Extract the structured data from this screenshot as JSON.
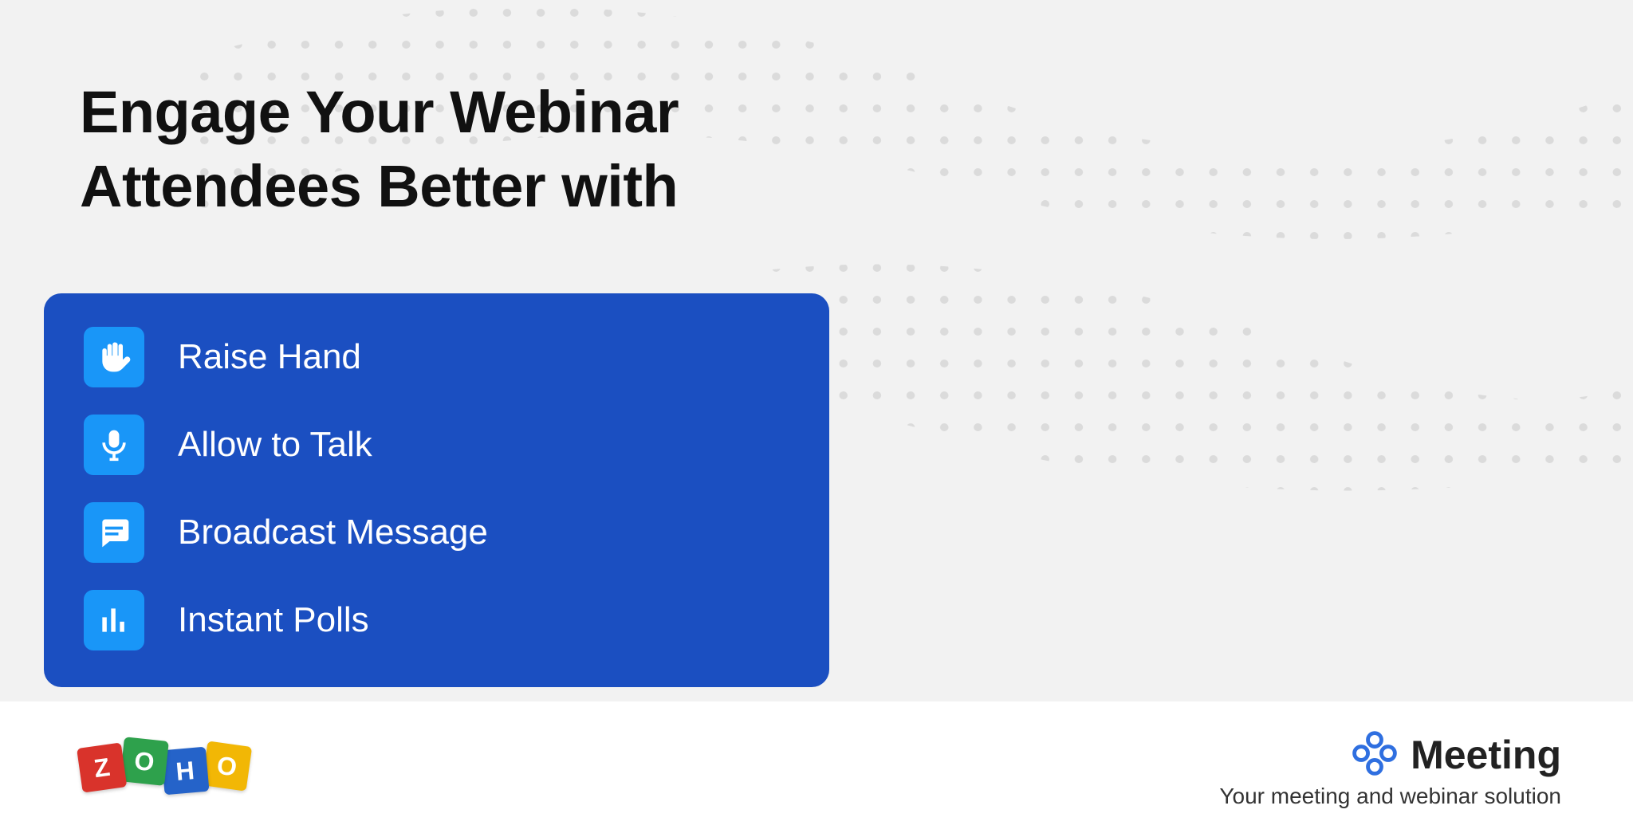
{
  "headline": {
    "line1": "Engage Your Webinar",
    "line2": "Attendees Better with"
  },
  "features": [
    {
      "icon": "hand-icon",
      "label": "Raise Hand"
    },
    {
      "icon": "mic-icon",
      "label": "Allow to Talk"
    },
    {
      "icon": "message-icon",
      "label": "Broadcast Message"
    },
    {
      "icon": "poll-icon",
      "label": "Instant Polls"
    }
  ],
  "footer": {
    "zoho_letters": [
      "Z",
      "O",
      "H",
      "O"
    ],
    "product_name": "Meeting",
    "tagline": "Your meeting and webinar solution"
  },
  "colors": {
    "card_bg": "#1b4fc1",
    "icon_bg": "#1996f8",
    "page_bg": "#f2f2f2"
  }
}
